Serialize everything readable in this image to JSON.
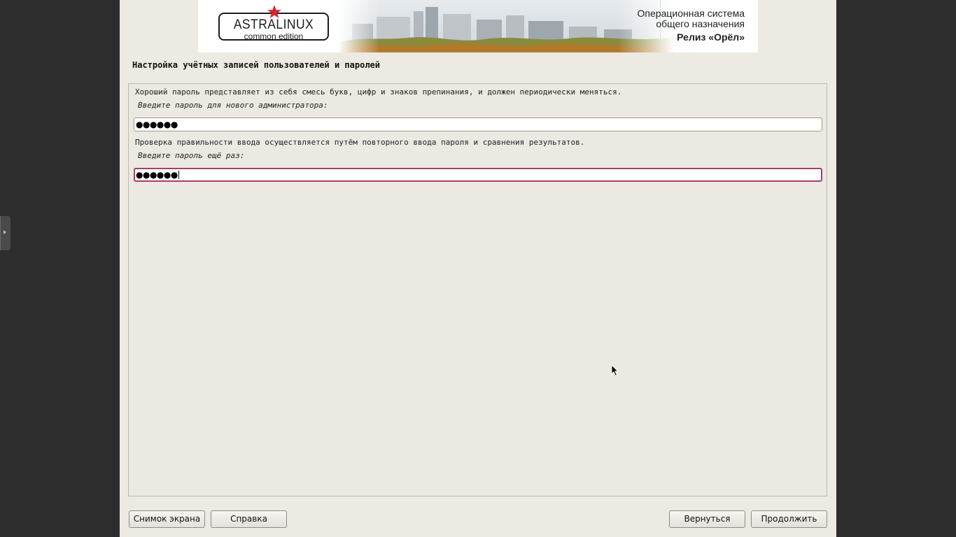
{
  "banner": {
    "logo_name": "ASTRALINUX",
    "logo_sub": "common edition",
    "line1": "Операционная система",
    "line2": "общего назначения",
    "line3": "Релиз «Орёл»"
  },
  "page": {
    "title": "Настройка учётных записей пользователей и паролей"
  },
  "form": {
    "description1": "Хороший пароль представляет из себя смесь букв, цифр и знаков препинания, и должен периодически меняться.",
    "prompt1": "Введите пароль для нового администратора:",
    "password1_masked": "●●●●●●",
    "description2": "Проверка правильности ввода осуществляется путём повторного ввода пароля и сравнения результатов.",
    "prompt2": "Введите пароль ещё раз:",
    "password2_masked": "●●●●●●"
  },
  "buttons": {
    "screenshot": "Снимок экрана",
    "help": "Справка",
    "back": "Вернуться",
    "continue": "Продолжить"
  },
  "colors": {
    "accent_focus": "#a0416a",
    "logo_star": "#d8232a",
    "background": "#ede9e3"
  },
  "icons": {
    "side_tab": "chevron-right-icon",
    "logo": "red-star-icon",
    "pointer": "mouse-pointer-icon"
  }
}
